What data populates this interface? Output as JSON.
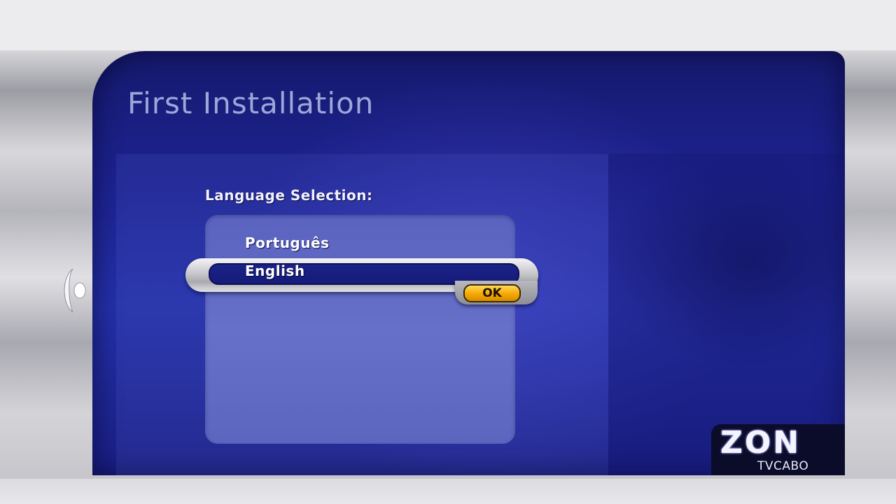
{
  "screen": {
    "title": "First Installation",
    "section_label": "Language Selection:",
    "languages": [
      {
        "label": "Português",
        "selected": false
      },
      {
        "label": "English",
        "selected": true
      }
    ],
    "ok_label": "OK"
  },
  "brand": {
    "name": "ZON",
    "sub": "TVCABO"
  },
  "colors": {
    "panel_blue": "#1c2290",
    "ok_orange": "#f5a800"
  }
}
